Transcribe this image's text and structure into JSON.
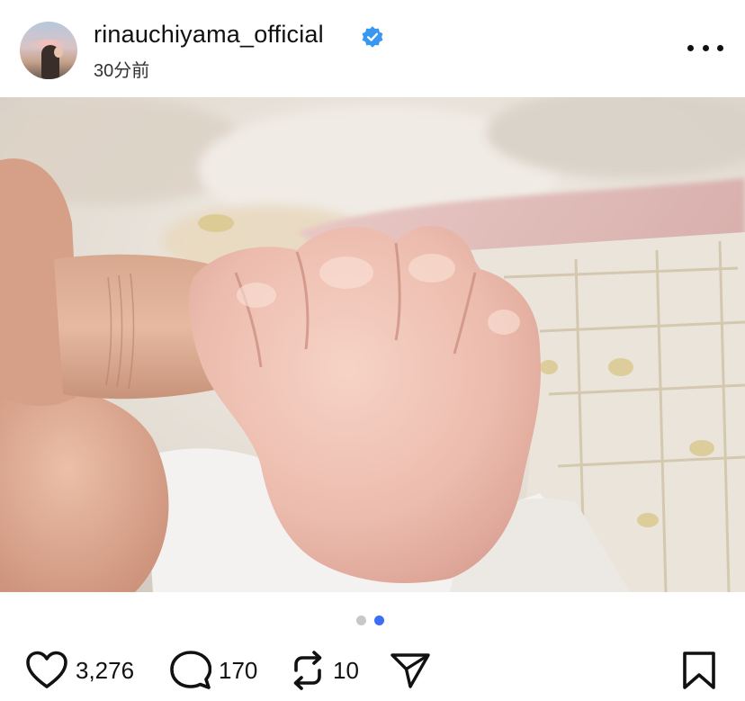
{
  "header": {
    "username": "rinauchiyama_official",
    "timestamp": "30分前",
    "verified_icon": "verified-badge-icon",
    "more_icon": "more-options-icon"
  },
  "photo": {
    "icon": "baby-hand-photo"
  },
  "carousel": {
    "total": 2,
    "active_index": 1
  },
  "actions": {
    "likes": "3,276",
    "comments": "170",
    "reposts": "10",
    "icons": [
      "heart-icon",
      "comment-icon",
      "repost-icon",
      "send-icon",
      "bookmark-icon"
    ]
  },
  "colors": {
    "verified_blue": "#3897f0",
    "active_dot": "#3b6ef5",
    "inactive_dot": "#c8c8c8"
  }
}
